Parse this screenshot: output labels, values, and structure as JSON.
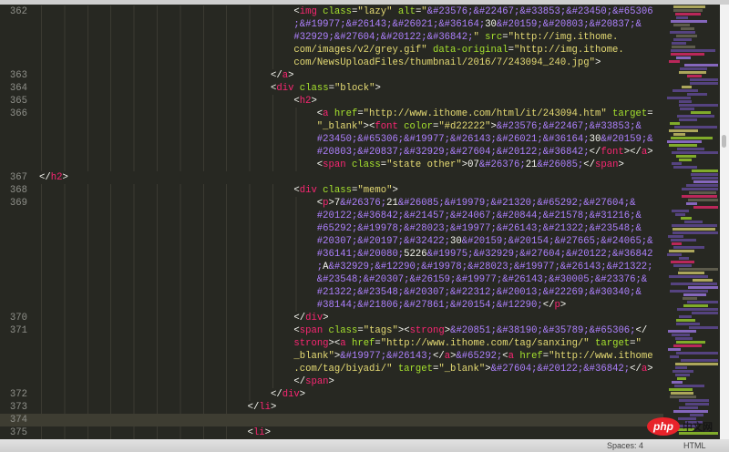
{
  "editor": {
    "current_line": 374,
    "lines": [
      {
        "num": "362",
        "indent": 11,
        "rows": [
          [
            [
              "p",
              "<"
            ],
            [
              "t",
              "img"
            ],
            [
              "a",
              " class"
            ],
            [
              "p",
              "="
            ],
            [
              "s",
              "\"lazy\""
            ],
            [
              "a",
              " alt"
            ],
            [
              "p",
              "="
            ],
            [
              "s",
              "\""
            ],
            [
              "e",
              "&#23576;&#22467;&#33853;&#23450;&#65306"
            ]
          ],
          [
            [
              "e",
              ";&#19977;&#26143;&#26021;&#36164;"
            ],
            [
              "x",
              "30"
            ],
            [
              "e",
              "&#20159;&#20803;&#20837;&"
            ]
          ],
          [
            [
              "e",
              "#32929;&#27604;&#20122;&#36842;"
            ],
            [
              "s",
              "\""
            ],
            [
              "a",
              " src"
            ],
            [
              "p",
              "="
            ],
            [
              "s",
              "\"http://img.ithome."
            ]
          ],
          [
            [
              "s",
              "com/images/v2/grey.gif\""
            ],
            [
              "a",
              " data-original"
            ],
            [
              "p",
              "="
            ],
            [
              "s",
              "\"http://img.ithome."
            ]
          ],
          [
            [
              "s",
              "com/NewsUploadFiles/thumbnail/2016/7/243094_240.jpg\""
            ],
            [
              "p",
              ">"
            ]
          ]
        ]
      },
      {
        "num": "363",
        "indent": 10,
        "rows": [
          [
            [
              "p",
              "</"
            ],
            [
              "t",
              "a"
            ],
            [
              "p",
              ">"
            ]
          ]
        ]
      },
      {
        "num": "364",
        "indent": 10,
        "rows": [
          [
            [
              "p",
              "<"
            ],
            [
              "t",
              "div"
            ],
            [
              "a",
              " class"
            ],
            [
              "p",
              "="
            ],
            [
              "s",
              "\"block\""
            ],
            [
              "p",
              ">"
            ]
          ]
        ]
      },
      {
        "num": "365",
        "indent": 11,
        "rows": [
          [
            [
              "p",
              "<"
            ],
            [
              "t",
              "h2"
            ],
            [
              "p",
              ">"
            ]
          ]
        ]
      },
      {
        "num": "366",
        "indent": 12,
        "rows": [
          [
            [
              "p",
              "<"
            ],
            [
              "t",
              "a"
            ],
            [
              "a",
              " href"
            ],
            [
              "p",
              "="
            ],
            [
              "s",
              "\"http://www.ithome.com/html/it/243094.htm\""
            ],
            [
              "a",
              " target"
            ],
            [
              "p",
              "="
            ]
          ],
          [
            [
              "s",
              "\"_blank\""
            ],
            [
              "p",
              "><"
            ],
            [
              "t",
              "font"
            ],
            [
              "a",
              " color"
            ],
            [
              "p",
              "="
            ],
            [
              "s",
              "\"#d22222\""
            ],
            [
              "p",
              ">"
            ],
            [
              "e",
              "&#23576;&#22467;&#33853;&"
            ]
          ],
          [
            [
              "e",
              "#23450;&#65306;&#19977;&#26143;&#26021;&#36164;"
            ],
            [
              "x",
              "30"
            ],
            [
              "e",
              "&#20159;&"
            ]
          ],
          [
            [
              "e",
              "#20803;&#20837;&#32929;&#27604;&#20122;&#36842;"
            ],
            [
              "p",
              "</"
            ],
            [
              "t",
              "font"
            ],
            [
              "p",
              "></"
            ],
            [
              "t",
              "a"
            ],
            [
              "p",
              ">"
            ]
          ],
          [
            [
              "p",
              "<"
            ],
            [
              "t",
              "span"
            ],
            [
              "a",
              " class"
            ],
            [
              "p",
              "="
            ],
            [
              "s",
              "\"state other\""
            ],
            [
              "p",
              ">"
            ],
            [
              "x",
              "07"
            ],
            [
              "e",
              "&#26376;"
            ],
            [
              "x",
              "21"
            ],
            [
              "e",
              "&#26085;"
            ],
            [
              "p",
              "</"
            ],
            [
              "t",
              "span"
            ],
            [
              "p",
              ">"
            ]
          ]
        ]
      },
      {
        "num": "367",
        "indent": 0,
        "rows": [
          [
            [
              "p",
              "</"
            ],
            [
              "t",
              "h2"
            ],
            [
              "p",
              ">"
            ]
          ]
        ]
      },
      {
        "num": "368",
        "indent": 11,
        "rows": [
          [
            [
              "p",
              "<"
            ],
            [
              "t",
              "div"
            ],
            [
              "a",
              " class"
            ],
            [
              "p",
              "="
            ],
            [
              "s",
              "\"memo\""
            ],
            [
              "p",
              ">"
            ]
          ]
        ]
      },
      {
        "num": "369",
        "indent": 12,
        "rows": [
          [
            [
              "p",
              "<"
            ],
            [
              "t",
              "p"
            ],
            [
              "p",
              ">"
            ],
            [
              "x",
              "7"
            ],
            [
              "e",
              "&#26376;"
            ],
            [
              "x",
              "21"
            ],
            [
              "e",
              "&#26085;&#19979;&#21320;&#65292;&#27604;&"
            ]
          ],
          [
            [
              "e",
              "#20122;&#36842;&#21457;&#24067;&#20844;&#21578;&#31216;&"
            ]
          ],
          [
            [
              "e",
              "#65292;&#19978;&#28023;&#19977;&#26143;&#21322;&#23548;&"
            ]
          ],
          [
            [
              "e",
              "#20307;&#20197;&#32422;"
            ],
            [
              "x",
              "30"
            ],
            [
              "e",
              "&#20159;&#20154;&#27665;&#24065;&"
            ]
          ],
          [
            [
              "e",
              "#36141;&#20080;"
            ],
            [
              "x",
              "5226"
            ],
            [
              "e",
              "&#19975;&#32929;&#27604;&#20122;&#36842"
            ]
          ],
          [
            [
              "e",
              ";"
            ],
            [
              "x",
              "A"
            ],
            [
              "e",
              "&#32929;&#12290;&#19978;&#28023;&#19977;&#26143;&#21322;"
            ]
          ],
          [
            [
              "e",
              "&#23548;&#20307;&#26159;&#19977;&#26143;&#30005;&#23376;&"
            ]
          ],
          [
            [
              "e",
              "#21322;&#23548;&#20307;&#22312;&#20013;&#22269;&#30340;&"
            ]
          ],
          [
            [
              "e",
              "#38144;&#21806;&#27861;&#20154;&#12290;"
            ],
            [
              "p",
              "</"
            ],
            [
              "t",
              "p"
            ],
            [
              "p",
              ">"
            ]
          ]
        ]
      },
      {
        "num": "370",
        "indent": 11,
        "rows": [
          [
            [
              "p",
              "</"
            ],
            [
              "t",
              "div"
            ],
            [
              "p",
              ">"
            ]
          ]
        ]
      },
      {
        "num": "371",
        "indent": 11,
        "rows": [
          [
            [
              "p",
              "<"
            ],
            [
              "t",
              "span"
            ],
            [
              "a",
              " class"
            ],
            [
              "p",
              "="
            ],
            [
              "s",
              "\"tags\""
            ],
            [
              "p",
              "><"
            ],
            [
              "t",
              "strong"
            ],
            [
              "p",
              ">"
            ],
            [
              "e",
              "&#20851;&#38190;&#35789;&#65306;"
            ],
            [
              "p",
              "</"
            ]
          ],
          [
            [
              "t",
              "strong"
            ],
            [
              "p",
              "><"
            ],
            [
              "t",
              "a"
            ],
            [
              "a",
              " href"
            ],
            [
              "p",
              "="
            ],
            [
              "s",
              "\"http://www.ithome.com/tag/sanxing/\""
            ],
            [
              "a",
              " target"
            ],
            [
              "p",
              "="
            ],
            [
              "s",
              "\""
            ]
          ],
          [
            [
              "s",
              "_blank\""
            ],
            [
              "p",
              ">"
            ],
            [
              "e",
              "&#19977;&#26143;"
            ],
            [
              "p",
              "</"
            ],
            [
              "t",
              "a"
            ],
            [
              "p",
              ">"
            ],
            [
              "e",
              "&#65292;"
            ],
            [
              "p",
              "<"
            ],
            [
              "t",
              "a"
            ],
            [
              "a",
              " href"
            ],
            [
              "p",
              "="
            ],
            [
              "s",
              "\"http://www.ithome"
            ]
          ],
          [
            [
              "s",
              ".com/tag/biyadi/\""
            ],
            [
              "a",
              " target"
            ],
            [
              "p",
              "="
            ],
            [
              "s",
              "\"_blank\""
            ],
            [
              "p",
              ">"
            ],
            [
              "e",
              "&#27604;&#20122;&#36842;"
            ],
            [
              "p",
              "</"
            ],
            [
              "t",
              "a"
            ],
            [
              "p",
              ">"
            ]
          ],
          [
            [
              "p",
              "</"
            ],
            [
              "t",
              "span"
            ],
            [
              "p",
              ">"
            ]
          ]
        ]
      },
      {
        "num": "372",
        "indent": 10,
        "rows": [
          [
            [
              "p",
              "</"
            ],
            [
              "t",
              "div"
            ],
            [
              "p",
              ">"
            ]
          ]
        ]
      },
      {
        "num": "373",
        "indent": 9,
        "rows": [
          [
            [
              "p",
              "</"
            ],
            [
              "t",
              "li"
            ],
            [
              "p",
              ">"
            ]
          ]
        ]
      },
      {
        "num": "374",
        "indent": 0,
        "rows": [
          []
        ]
      },
      {
        "num": "375",
        "indent": 9,
        "rows": [
          [
            [
              "p",
              "<"
            ],
            [
              "t",
              "li"
            ],
            [
              "p",
              ">"
            ]
          ]
        ]
      }
    ]
  },
  "status_bar": {
    "indentation": "Spaces: 4",
    "syntax": "HTML"
  },
  "watermark": {
    "logo": "php",
    "text": "中文网"
  },
  "colors": {
    "background": "#272822",
    "tag": "#f92672",
    "attribute": "#a6e22e",
    "string": "#e6db74",
    "entity": "#ae81ff",
    "line_highlight": "#3e3d32"
  }
}
